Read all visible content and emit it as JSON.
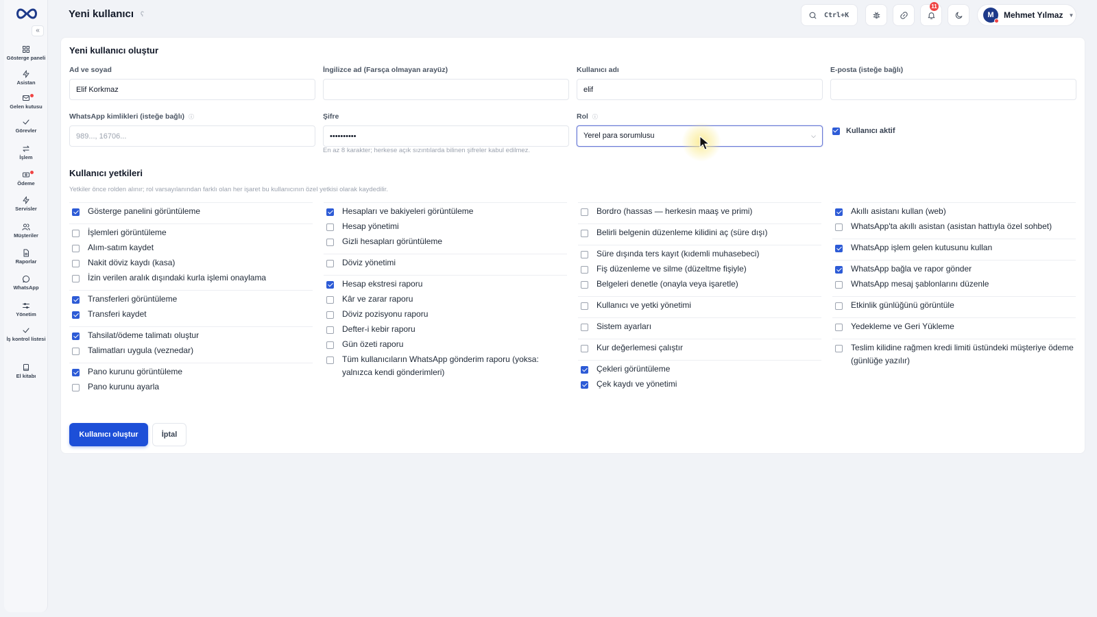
{
  "header": {
    "title": "Yeni kullanıcı",
    "info_icon": "info-icon",
    "search_shortcut": "Ctrl+K",
    "notifications_count": "11",
    "user_initial": "M",
    "user_name": "Mehmet Yılmaz"
  },
  "sidebar": {
    "collapse_icon": "«",
    "items": [
      {
        "label": "Gösterge paneli",
        "icon": "dashboard-icon"
      },
      {
        "label": "Asistan",
        "icon": "lightning-icon"
      },
      {
        "label": "Gelen kutusu",
        "icon": "inbox-icon"
      },
      {
        "label": "Görevler",
        "icon": "check-icon"
      },
      {
        "label": "İşlem",
        "icon": "transfer-icon"
      },
      {
        "label": "Ödeme",
        "icon": "payment-icon"
      },
      {
        "label": "Servisler",
        "icon": "lightning-icon"
      },
      {
        "label": "Müşteriler",
        "icon": "users-icon"
      },
      {
        "label": "Raporlar",
        "icon": "report-icon"
      },
      {
        "label": "WhatsApp",
        "icon": "chat-icon"
      },
      {
        "label": "Yönetim",
        "icon": "sliders-icon"
      },
      {
        "label": "İş kontrol listesi",
        "icon": "check-icon"
      },
      {
        "label": "El kitabı",
        "icon": "book-icon"
      }
    ]
  },
  "form": {
    "title": "Yeni kullanıcı oluştur",
    "fields": {
      "full_name": {
        "label": "Ad ve soyad",
        "value": "Elif Korkmaz"
      },
      "english_name": {
        "label": "İngilizce ad (Farsça olmayan arayüz)",
        "value": ""
      },
      "username": {
        "label": "Kullanıcı adı",
        "value": "elif"
      },
      "email": {
        "label": "E-posta (isteğe bağlı)",
        "value": ""
      },
      "whatsapp": {
        "label": "WhatsApp kimlikleri (isteğe bağlı)",
        "placeholder": "989..., 16706..."
      },
      "password": {
        "label": "Şifre",
        "value": "••••••••••",
        "hint": "En az 8 karakter; herkese açık sızıntılarda bilinen şifreler kabul edilmez."
      },
      "role": {
        "label": "Rol",
        "value": "Yerel para sorumlusu"
      },
      "active": {
        "label": "Kullanıcı aktif",
        "checked": true
      }
    },
    "info_badge": "ⓘ"
  },
  "permissions": {
    "title": "Kullanıcı yetkileri",
    "description": "Yetkiler önce rolden alınır; rol varsayılanından farklı olan her işaret bu kullanıcının özel yetkisi olarak kaydedilir.",
    "columns": [
      [
        [
          {
            "label": "Gösterge panelini görüntüleme",
            "checked": true
          }
        ],
        [
          {
            "label": "İşlemleri görüntüleme",
            "checked": false
          },
          {
            "label": "Alım-satım kaydet",
            "checked": false
          },
          {
            "label": "Nakit döviz kaydı (kasa)",
            "checked": false
          },
          {
            "label": "İzin verilen aralık dışındaki kurla işlemi onaylama",
            "checked": false
          }
        ],
        [
          {
            "label": "Transferleri görüntüleme",
            "checked": true
          },
          {
            "label": "Transferi kaydet",
            "checked": true
          }
        ],
        [
          {
            "label": "Tahsilat/ödeme talimatı oluştur",
            "checked": true
          },
          {
            "label": "Talimatları uygula (veznedar)",
            "checked": false
          }
        ],
        [
          {
            "label": "Pano kurunu görüntüleme",
            "checked": true
          },
          {
            "label": "Pano kurunu ayarla",
            "checked": false
          }
        ]
      ],
      [
        [
          {
            "label": "Hesapları ve bakiyeleri görüntüleme",
            "checked": true
          },
          {
            "label": "Hesap yönetimi",
            "checked": false
          },
          {
            "label": "Gizli hesapları görüntüleme",
            "checked": false
          }
        ],
        [
          {
            "label": "Döviz yönetimi",
            "checked": false
          }
        ],
        [
          {
            "label": "Hesap ekstresi raporu",
            "checked": true
          },
          {
            "label": "Kâr ve zarar raporu",
            "checked": false
          },
          {
            "label": "Döviz pozisyonu raporu",
            "checked": false
          },
          {
            "label": "Defter-i kebir raporu",
            "checked": false
          },
          {
            "label": "Gün özeti raporu",
            "checked": false
          },
          {
            "label": "Tüm kullanıcıların WhatsApp gönderim raporu (yoksa: yalnızca kendi gönderimleri)",
            "checked": false
          }
        ]
      ],
      [
        [
          {
            "label": "Bordro (hassas — herkesin maaş ve primi)",
            "checked": false
          }
        ],
        [
          {
            "label": "Belirli belgenin düzenleme kilidini aç (süre dışı)",
            "checked": false
          }
        ],
        [
          {
            "label": "Süre dışında ters kayıt (kıdemli muhasebeci)",
            "checked": false
          },
          {
            "label": "Fiş düzenleme ve silme (düzeltme fişiyle)",
            "checked": false
          },
          {
            "label": "Belgeleri denetle (onayla veya işaretle)",
            "checked": false
          }
        ],
        [
          {
            "label": "Kullanıcı ve yetki yönetimi",
            "checked": false
          }
        ],
        [
          {
            "label": "Sistem ayarları",
            "checked": false
          }
        ],
        [
          {
            "label": "Kur değerlemesi çalıştır",
            "checked": false
          }
        ],
        [
          {
            "label": "Çekleri görüntüleme",
            "checked": true
          },
          {
            "label": "Çek kaydı ve yönetimi",
            "checked": true
          }
        ]
      ],
      [
        [
          {
            "label": "Akıllı asistanı kullan (web)",
            "checked": true
          },
          {
            "label": "WhatsApp'ta akıllı asistan (asistan hattıyla özel sohbet)",
            "checked": false
          }
        ],
        [
          {
            "label": "WhatsApp işlem gelen kutusunu kullan",
            "checked": true
          }
        ],
        [
          {
            "label": "WhatsApp bağla ve rapor gönder",
            "checked": true
          },
          {
            "label": "WhatsApp mesaj şablonlarını düzenle",
            "checked": false
          }
        ],
        [
          {
            "label": "Etkinlik günlüğünü görüntüle",
            "checked": false
          }
        ],
        [
          {
            "label": "Yedekleme ve Geri Yükleme",
            "checked": false
          }
        ],
        [
          {
            "label": "Teslim kilidine rağmen kredi limiti üstündeki müşteriye ödeme (günlüğe yazılır)",
            "checked": false
          }
        ]
      ]
    ]
  },
  "actions": {
    "create_label": "Kullanıcı oluştur",
    "cancel_label": "İptal"
  },
  "colors": {
    "primary": "#1d4fd8",
    "checkbox": "#2d5bd6",
    "badge": "#ef4444"
  }
}
